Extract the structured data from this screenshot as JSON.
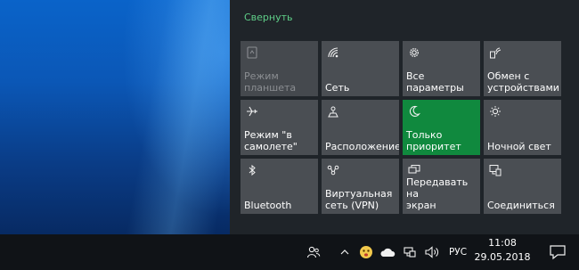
{
  "action_center": {
    "collapse_label": "Свернуть",
    "accent_color": "#10893e",
    "tiles": [
      {
        "label": "Режим\nпланшета",
        "icon": "tablet-mode-icon",
        "state": "disabled"
      },
      {
        "label": "Сеть",
        "icon": "network-icon",
        "state": "normal"
      },
      {
        "label": "Все параметры",
        "icon": "gear-icon",
        "state": "normal"
      },
      {
        "label": "Обмен с\nустройствами",
        "icon": "nearby-sharing-icon",
        "state": "normal"
      },
      {
        "label": "Режим \"в\nсамолете\"",
        "icon": "airplane-icon",
        "state": "normal"
      },
      {
        "label": "Расположение",
        "icon": "location-icon",
        "state": "normal"
      },
      {
        "label": "Только\nприоритет",
        "icon": "moon-icon",
        "state": "active"
      },
      {
        "label": "Ночной свет",
        "icon": "brightness-icon",
        "state": "normal"
      },
      {
        "label": "Bluetooth",
        "icon": "bluetooth-icon",
        "state": "normal"
      },
      {
        "label": "Виртуальная\nсеть (VPN)",
        "icon": "vpn-icon",
        "state": "normal"
      },
      {
        "label": "Передавать на\nэкран",
        "icon": "project-icon",
        "state": "normal"
      },
      {
        "label": "Соединиться",
        "icon": "connect-icon",
        "state": "normal"
      }
    ]
  },
  "taskbar": {
    "language": "РУС",
    "time": "11:08",
    "date": "29.05.2018"
  }
}
